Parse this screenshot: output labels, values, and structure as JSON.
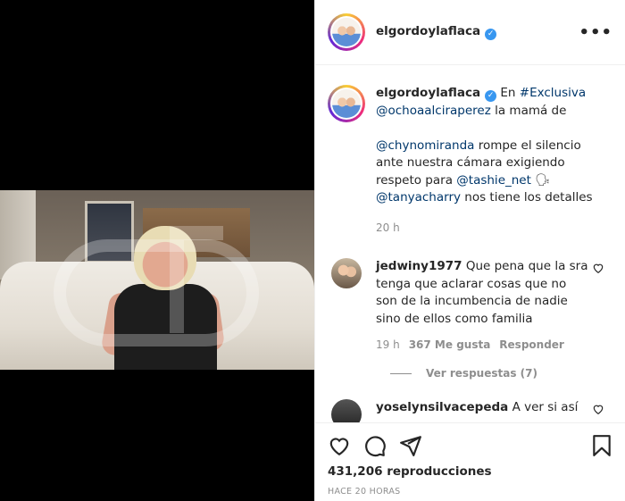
{
  "post": {
    "username": "elgordoylaflaca",
    "verified_icon": "verified-badge-icon",
    "more_icon": "more-options-icon"
  },
  "caption": {
    "username": "elgordoylaflaca",
    "text_1": " En ",
    "hashtag": "#Exclusiva",
    "mention_1": "@ochoaalciraperez",
    "text_2": " la mamá de",
    "mention_2": "@chynomiranda",
    "text_3": " rompe el silencio ante nuestra cámara exigiendo respeto para ",
    "mention_3": "@tashie_net",
    "emoji": " 🗣",
    "mention_4": "@tanyacharry",
    "text_4": " nos tiene los detalles",
    "time": "20 h"
  },
  "comments": [
    {
      "username": "jedwiny1977",
      "text": "Que pena que la sra tenga que aclarar cosas que no son de la incumbencia de nadie sino de ellos como familia",
      "time": "19 h",
      "likes": "367 Me gusta",
      "reply": "Responder",
      "view_replies": "Ver respuestas (7)"
    },
    {
      "username": "yoselynsilvacepeda",
      "text": "A ver si así"
    }
  ],
  "actions": {
    "like_icon": "heart-icon",
    "comment_icon": "comment-icon",
    "share_icon": "share-icon",
    "save_icon": "bookmark-icon",
    "views": "431,206 reproducciones",
    "posted": "HACE 20 HORAS"
  }
}
